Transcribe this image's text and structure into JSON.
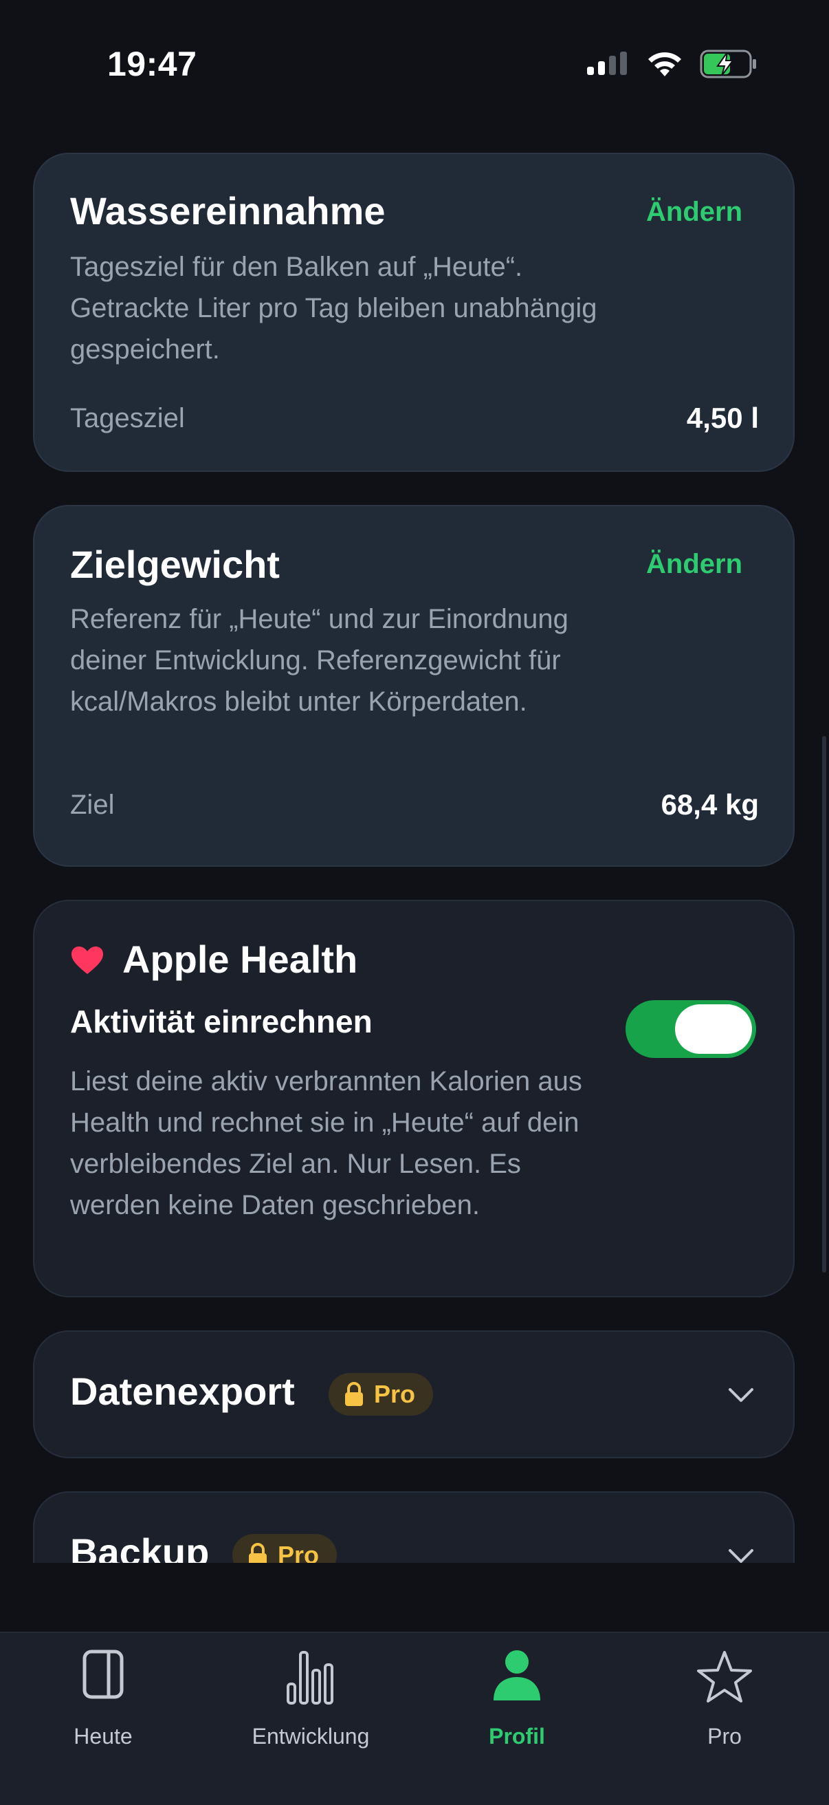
{
  "status_bar": {
    "time": "19:47"
  },
  "cards": {
    "water": {
      "title": "Wassereinnahme",
      "action": "Ändern",
      "description": "Tagesziel für den Balken auf „Heute“. Getrackte Liter pro Tag bleiben unabhängig gespeichert.",
      "row_label": "Tagesziel",
      "row_value": "4,50 l"
    },
    "weight": {
      "title": "Zielgewicht",
      "action": "Ändern",
      "description": "Referenz für „Heute“ und zur Einordnung deiner Entwicklung. Referenzgewicht für kcal/Makros bleibt unter Körperdaten.",
      "row_label": "Ziel",
      "row_value": "68,4 kg"
    },
    "health": {
      "title": "Apple Health",
      "toggle_label": "Aktivität einrechnen",
      "toggle_on": true,
      "description": "Liest deine aktiv verbrannten Kalorien aus Health und rechnet sie in „Heute“ auf dein verbleibendes Ziel an. Nur Lesen. Es werden keine Daten geschrieben."
    },
    "export": {
      "title": "Datenexport",
      "badge": "Pro"
    },
    "backup": {
      "title": "Backup",
      "badge": "Pro"
    }
  },
  "tabbar": {
    "tabs": [
      {
        "label": "Heute"
      },
      {
        "label": "Entwicklung"
      },
      {
        "label": "Profil"
      },
      {
        "label": "Pro"
      }
    ],
    "active": "Profil"
  },
  "colors": {
    "accent": "#2ecc71",
    "toggle_on": "#16a34a",
    "pro_badge": "#f6c344",
    "heart": "#ff375f",
    "background": "#0f1117",
    "card": "#212a37"
  }
}
